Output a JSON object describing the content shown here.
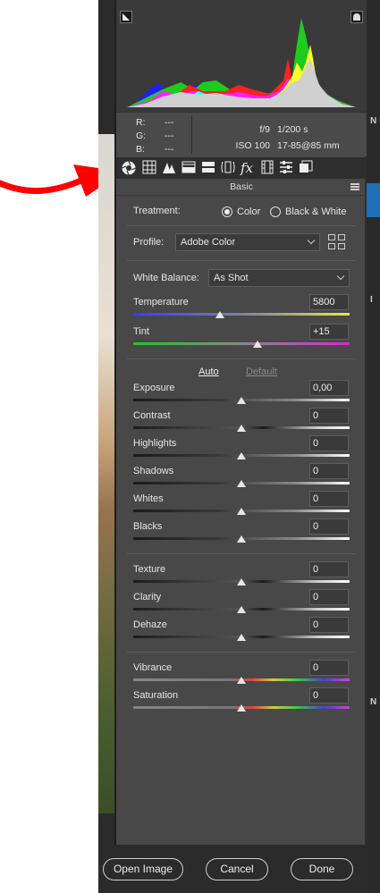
{
  "histogram": {
    "shadow_clip_icon": "shadow-clipping-icon",
    "highlight_clip_icon": "highlight-clipping-icon"
  },
  "info": {
    "r_label": "R:",
    "r_val": "---",
    "g_label": "G:",
    "g_val": "---",
    "b_label": "B:",
    "b_val": "---",
    "aperture": "f/9",
    "shutter": "1/200 s",
    "iso": "ISO 100",
    "lens": "17-85@85 mm"
  },
  "toolbar": {
    "tools": [
      "basic-icon",
      "tone-curve-icon",
      "detail-icon",
      "hsl-icon",
      "split-toning-icon",
      "lens-corrections-icon",
      "effects-icon",
      "camera-calibration-icon",
      "presets-icon",
      "snapshots-icon"
    ],
    "fx": "fx"
  },
  "panel": {
    "title": "Basic",
    "treatment_label": "Treatment:",
    "treatment_color": "Color",
    "treatment_bw": "Black & White",
    "profile_label": "Profile:",
    "profile_value": "Adobe Color",
    "wb_label": "White Balance:",
    "wb_value": "As Shot",
    "temperature_label": "Temperature",
    "temperature_value": "5800",
    "tint_label": "Tint",
    "tint_value": "+15",
    "auto": "Auto",
    "default": "Default",
    "adjustments": [
      {
        "label": "Exposure",
        "value": "0,00"
      },
      {
        "label": "Contrast",
        "value": "0"
      },
      {
        "label": "Highlights",
        "value": "0"
      },
      {
        "label": "Shadows",
        "value": "0"
      },
      {
        "label": "Whites",
        "value": "0"
      },
      {
        "label": "Blacks",
        "value": "0"
      }
    ],
    "presence": [
      {
        "label": "Texture",
        "value": "0"
      },
      {
        "label": "Clarity",
        "value": "0"
      },
      {
        "label": "Dehaze",
        "value": "0"
      }
    ],
    "color_adj": [
      {
        "label": "Vibrance",
        "value": "0"
      },
      {
        "label": "Saturation",
        "value": "0"
      }
    ],
    "temperature_position": 0.4,
    "tint_position": 0.575
  },
  "footer": {
    "open_image": "Open Image",
    "cancel": "Cancel",
    "done": "Done"
  },
  "right_strip": {
    "char1": "N",
    "char2": "I",
    "char3": "N"
  }
}
